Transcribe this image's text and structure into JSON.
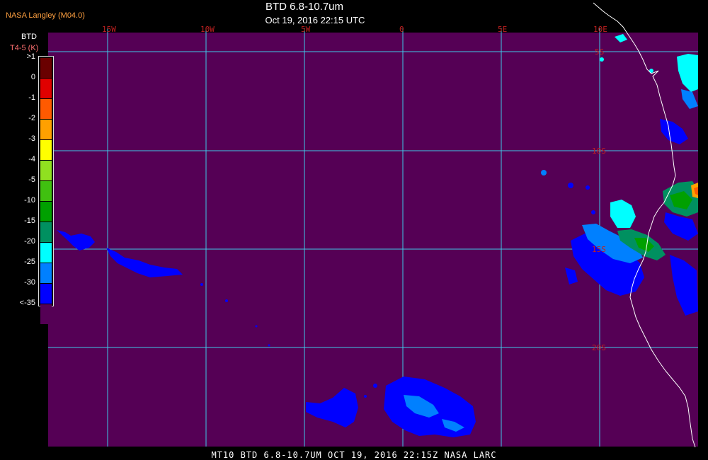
{
  "header": {
    "credit": "NASA Langley (M04.0)",
    "title": "BTD 6.8-10.7um",
    "subtitle": "Oct 19, 2016 22:15 UTC"
  },
  "legend": {
    "title": "BTD",
    "unit": "T4-5 (K)",
    "levels": [
      {
        "label": ">1",
        "color": "#6a0000"
      },
      {
        "label": "0",
        "color": "#e00000"
      },
      {
        "label": "-1",
        "color": "#ff5a00"
      },
      {
        "label": "-2",
        "color": "#ffa000"
      },
      {
        "label": "-3",
        "color": "#ffff00"
      },
      {
        "label": "-4",
        "color": "#90e020"
      },
      {
        "label": "-5",
        "color": "#40c010"
      },
      {
        "label": "-10",
        "color": "#00a000"
      },
      {
        "label": "-15",
        "color": "#009060"
      },
      {
        "label": "-20",
        "color": "#00ffff"
      },
      {
        "label": "-25",
        "color": "#0080ff"
      },
      {
        "label": "-30",
        "color": "#0000ff"
      },
      {
        "label": "<-35",
        "color": "#550055"
      }
    ]
  },
  "map": {
    "background_color": "#550055",
    "grid_color": "#40c8e8",
    "coast_color": "#ffffff",
    "lon_labels": [
      "15W",
      "10W",
      "5W",
      "0",
      "5E",
      "10E"
    ],
    "lat_labels": [
      "5S",
      "10S",
      "15S",
      "20S"
    ]
  },
  "footer": {
    "text": "MT10  BTD 6.8-10.7UM   OCT 19, 2016 22:15Z  NASA LARC"
  }
}
